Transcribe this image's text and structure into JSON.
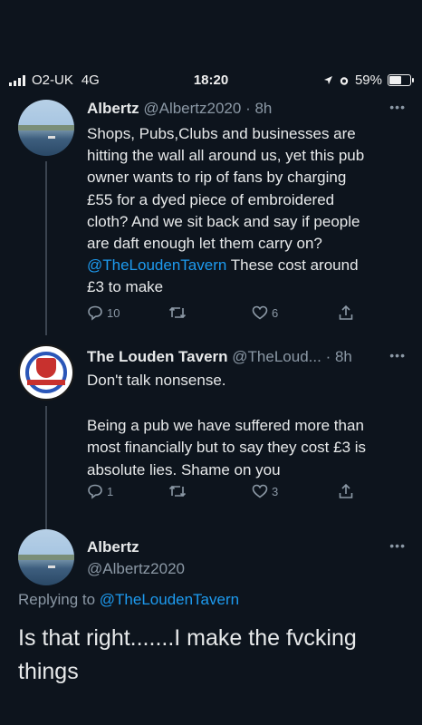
{
  "status_bar": {
    "carrier": "O2-UK",
    "network": "4G",
    "time": "18:20",
    "battery": "59%",
    "battery_level": 0.59
  },
  "tweets": [
    {
      "author": "Albertz",
      "handle": "@Albertz2020",
      "time": "· 8h",
      "text_lines": [
        "Shops, Pubs,Clubs and businesses are",
        "hitting the wall all around us, yet this pub",
        "owner wants to rip of fans by charging",
        "£55 for a dyed piece of embroidered",
        "cloth? And we sit back and say if people",
        "are daft enough let them carry on?"
      ],
      "mention": "@TheLoudenTavern",
      "text_after_mention": " These cost around",
      "text_last": "£3 to make",
      "replies": "10",
      "retweets": "",
      "likes": "6"
    },
    {
      "author": "The Louden Tavern",
      "handle": "@TheLoud...",
      "time": "· 8h",
      "text_lines": [
        "Don't talk nonsense.",
        "",
        "Being a pub we have suffered more than",
        "most financially but to say they cost £3 is",
        "absolute lies.  Shame on you"
      ],
      "replies": "1",
      "retweets": "",
      "likes": "3"
    },
    {
      "author": "Albertz",
      "handle": "@Albertz2020",
      "replying_label": "Replying to ",
      "replying_to": "@TheLoudenTavern",
      "text_lines": [
        "Is that right.......I make the fvcking",
        "things"
      ]
    }
  ],
  "icons": {
    "more": "more-icon",
    "reply": "reply-icon",
    "retweet": "retweet-icon",
    "like": "like-icon",
    "share": "share-icon"
  },
  "colors": {
    "background": "#0d141d",
    "mention": "#1d9bf0",
    "muted": "#8b98a5"
  }
}
